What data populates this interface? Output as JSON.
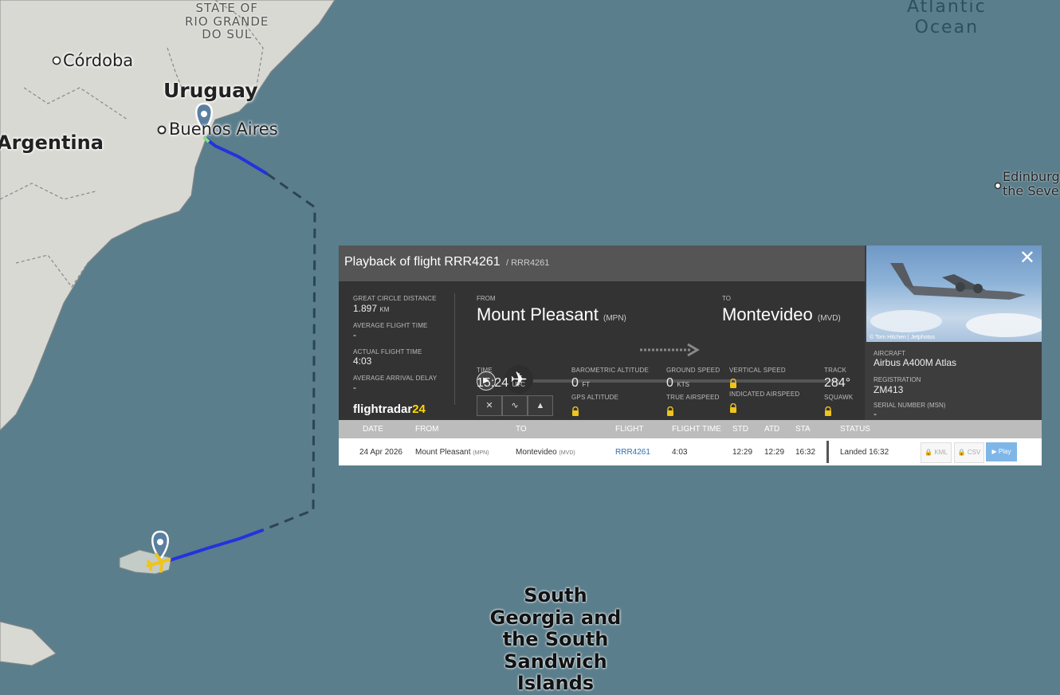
{
  "map": {
    "labels": {
      "state": "STATE OF\nRIO GRANDE\nDO SUL",
      "cordoba": "Córdoba",
      "uruguay": "Uruguay",
      "buenos_aires": "Buenos Aires",
      "argentina": "Argentina",
      "atlantic": "Atlantic\nOcean",
      "edinburgh": "Edinburg\nthe Seve",
      "south_georgia": "South\nGeorgia and\nthe South\nSandwich\nIslands"
    }
  },
  "panel": {
    "title": "Playback of flight RRR4261",
    "subtitle": "/ RRR4261",
    "stats": {
      "distance_label": "GREAT CIRCLE DISTANCE",
      "distance_value": "1.897",
      "distance_unit": "KM",
      "avg_time_label": "AVERAGE FLIGHT TIME",
      "avg_time_value": "-",
      "actual_time_label": "ACTUAL FLIGHT TIME",
      "actual_time_value": "4:03",
      "avg_delay_label": "AVERAGE ARRIVAL DELAY",
      "avg_delay_value": "-"
    },
    "logo": {
      "text": "flightradar",
      "num": "24"
    },
    "from": {
      "label": "FROM",
      "city": "Mount Pleasant",
      "code": "(MPN)"
    },
    "to": {
      "label": "TO",
      "city": "Montevideo",
      "code": "(MVD)"
    },
    "time": {
      "label": "TIME",
      "value": "15:24",
      "unit": "UTC"
    },
    "baro_alt": {
      "label": "BAROMETRIC ALTITUDE",
      "value": "0",
      "unit": "FT"
    },
    "gps_alt": {
      "label": "GPS ALTITUDE"
    },
    "ground_speed": {
      "label": "GROUND SPEED",
      "value": "0",
      "unit": "KTS"
    },
    "true_airspeed": {
      "label": "TRUE AIRSPEED"
    },
    "vert_speed": {
      "label": "VERTICAL SPEED"
    },
    "ind_airspeed": {
      "label": "INDICATED AIRSPEED"
    },
    "track": {
      "label": "TRACK",
      "value": "284°"
    },
    "squawk": {
      "label": "SQUAWK"
    },
    "progress": 0
  },
  "aircraft": {
    "photo_credit": "© Tom Hitchen | Jetphotos",
    "aircraft_label": "AIRCRAFT",
    "aircraft_value": "Airbus A400M Atlas",
    "registration_label": "REGISTRATION",
    "registration_value": "ZM413",
    "serial_label": "SERIAL NUMBER (MSN)",
    "serial_value": "-"
  },
  "table": {
    "headers": [
      "DATE",
      "FROM",
      "TO",
      "FLIGHT",
      "FLIGHT TIME",
      "STD",
      "ATD",
      "STA",
      "STATUS"
    ],
    "row": {
      "date": "24 Apr 2026",
      "from": "Mount Pleasant",
      "from_code": "(MPN)",
      "to": "Montevideo",
      "to_code": "(MVD)",
      "flight": "RRR4261",
      "flight_time": "4:03",
      "std": "12:29",
      "atd": "12:29",
      "sta": "16:32",
      "status": "Landed 16:32"
    },
    "buttons": {
      "kml": "KML",
      "csv": "CSV",
      "play": "▶ Play"
    }
  },
  "colors": {
    "ocean": "#5b7e8c",
    "land": "#d9d9d4",
    "track": "#2233dd",
    "link": "#2f6fb0",
    "accent": "#ffd700"
  }
}
